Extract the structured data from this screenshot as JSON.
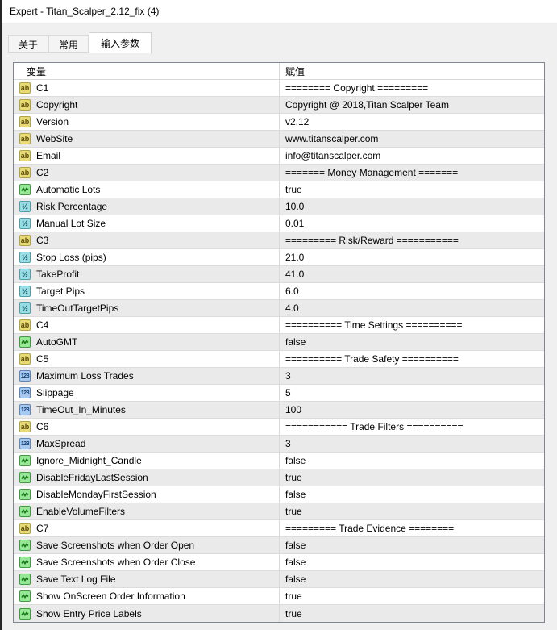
{
  "window": {
    "title": "Expert - Titan_Scalper_2.12_fix (4)"
  },
  "tabs": [
    {
      "label": "关于",
      "active": false
    },
    {
      "label": "常用",
      "active": false
    },
    {
      "label": "输入参数",
      "active": true
    }
  ],
  "colors": {
    "dialog_bg": "#f0f0f0",
    "row_alt_bg": "#eaeaea",
    "string_icon_bg": "#e8da74",
    "bool_icon_bg": "#98e698",
    "double_icon_bg": "#9adce2",
    "int_icon_bg": "#a9c9ec"
  },
  "table": {
    "columns": [
      "变量",
      "赋值"
    ],
    "icon_glyphs": {
      "string": "ab",
      "double": "½",
      "int": "123"
    },
    "rows": [
      {
        "type": "string",
        "name": "C1",
        "value": "======== Copyright ========="
      },
      {
        "type": "string",
        "name": "Copyright",
        "value": "Copyright @ 2018,Titan Scalper Team"
      },
      {
        "type": "string",
        "name": "Version",
        "value": "v2.12"
      },
      {
        "type": "string",
        "name": "WebSite",
        "value": "www.titanscalper.com"
      },
      {
        "type": "string",
        "name": "Email",
        "value": "info@titanscalper.com"
      },
      {
        "type": "string",
        "name": "C2",
        "value": "======= Money Management ======="
      },
      {
        "type": "bool",
        "name": "Automatic Lots",
        "value": "true"
      },
      {
        "type": "double",
        "name": "Risk Percentage",
        "value": "10.0"
      },
      {
        "type": "double",
        "name": "Manual Lot Size",
        "value": "0.01"
      },
      {
        "type": "string",
        "name": "C3",
        "value": "========= Risk/Reward ==========="
      },
      {
        "type": "double",
        "name": "Stop Loss (pips)",
        "value": "21.0"
      },
      {
        "type": "double",
        "name": "TakeProfit",
        "value": "41.0"
      },
      {
        "type": "double",
        "name": "Target Pips",
        "value": "6.0"
      },
      {
        "type": "double",
        "name": "TimeOutTargetPips",
        "value": "4.0"
      },
      {
        "type": "string",
        "name": "C4",
        "value": "========== Time Settings =========="
      },
      {
        "type": "bool",
        "name": "AutoGMT",
        "value": "false"
      },
      {
        "type": "string",
        "name": "C5",
        "value": "========== Trade Safety =========="
      },
      {
        "type": "int",
        "name": "Maximum Loss Trades",
        "value": "3"
      },
      {
        "type": "int",
        "name": "Slippage",
        "value": "5"
      },
      {
        "type": "int",
        "name": "TimeOut_In_Minutes",
        "value": "100"
      },
      {
        "type": "string",
        "name": "C6",
        "value": "=========== Trade Filters =========="
      },
      {
        "type": "int",
        "name": "MaxSpread",
        "value": "3"
      },
      {
        "type": "bool",
        "name": "Ignore_Midnight_Candle",
        "value": "false"
      },
      {
        "type": "bool",
        "name": "DisableFridayLastSession",
        "value": "true"
      },
      {
        "type": "bool",
        "name": "DisableMondayFirstSession",
        "value": "false"
      },
      {
        "type": "bool",
        "name": "EnableVolumeFilters",
        "value": "true"
      },
      {
        "type": "string",
        "name": "C7",
        "value": "========= Trade Evidence ========"
      },
      {
        "type": "bool",
        "name": "Save Screenshots when Order Open",
        "value": "false"
      },
      {
        "type": "bool",
        "name": "Save Screenshots when Order Close",
        "value": "false"
      },
      {
        "type": "bool",
        "name": "Save Text Log File",
        "value": "false"
      },
      {
        "type": "bool",
        "name": "Show OnScreen Order Information",
        "value": "true"
      },
      {
        "type": "bool",
        "name": "Show Entry Price Labels",
        "value": "true"
      }
    ]
  }
}
